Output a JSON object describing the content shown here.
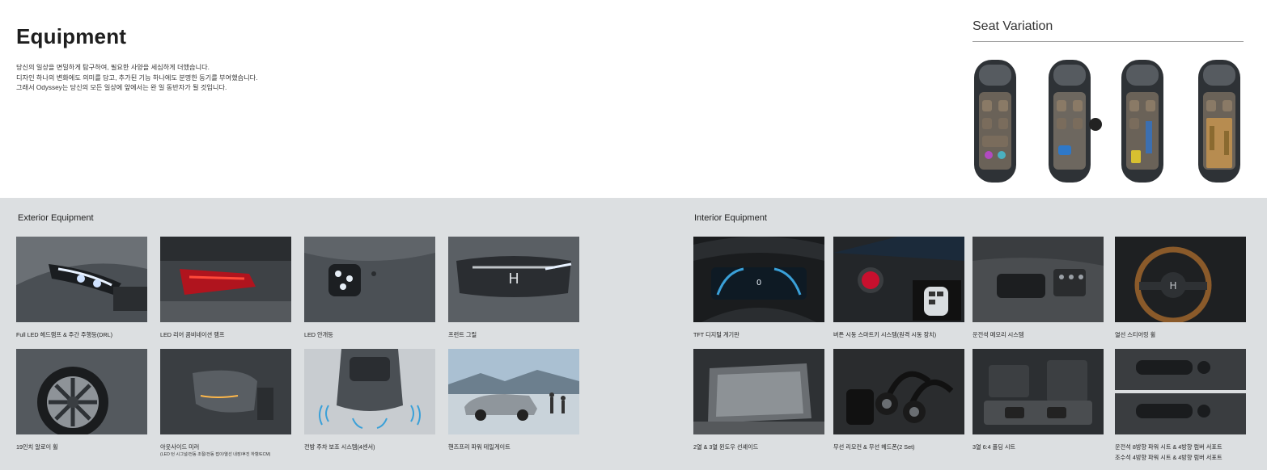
{
  "header": {
    "title": "Equipment",
    "intro_lines": [
      "당신의 일상을 면밀하게 탐구하여, 필요한 사양을 세심하게 더했습니다.",
      "디자인 하나의 변화에도 의미를 담고, 추가된 기능 하나에도 분명한 동기를 부여했습니다.",
      "그래서 Odyssey는 당신의 모든 일상에 앞에서는 완 일 동반자가 될 것입니다."
    ]
  },
  "seat_variation": {
    "title": "Seat Variation"
  },
  "exterior": {
    "title": "Exterior Equipment",
    "items": [
      {
        "caption": "Full LED 헤드램프 & 주간 주행등(DRL)"
      },
      {
        "caption": "LED 리어 콤비네이션 램프"
      },
      {
        "caption": "LED 안개등"
      },
      {
        "caption": "프런트 그릴"
      },
      {
        "caption": "19인치 알로이 휠"
      },
      {
        "caption": "아웃사이드 미러",
        "sub": "(LED 턴 시그널/전동 조절/전동 접이/열선 내장/후진 하향/ECM)"
      },
      {
        "caption": "전방 주차 보조 시스템(4센서)"
      },
      {
        "caption": "핸즈프리 파워 테일게이트"
      }
    ]
  },
  "interior": {
    "title": "Interior Equipment",
    "items": [
      {
        "caption": "TFT 디지털 계기판"
      },
      {
        "caption": "버튼 시동 스마트키 시스템(원격 시동 장치)"
      },
      {
        "caption": "운전석 메모리 시스템"
      },
      {
        "caption": "열선 스티어링 휠"
      },
      {
        "caption": "2열 & 3열 윈도우 선셰이드"
      },
      {
        "caption": "무선 리모컨 & 무선 헤드폰(2 Set)"
      },
      {
        "caption": "3열 6:4 폴딩 시트"
      },
      {
        "caption": "운전석 8방향 파워 시트 & 4방향 럼버 서포트",
        "sub": "조수석 4방향 파워 시트 & 4방향 럼버 서포트"
      }
    ]
  },
  "colors": {
    "bottom_bg": "#dcdfe1",
    "photo_dark": "#3b3f43",
    "accent_red": "#c8102e",
    "accent_blue": "#3aa0d8"
  }
}
